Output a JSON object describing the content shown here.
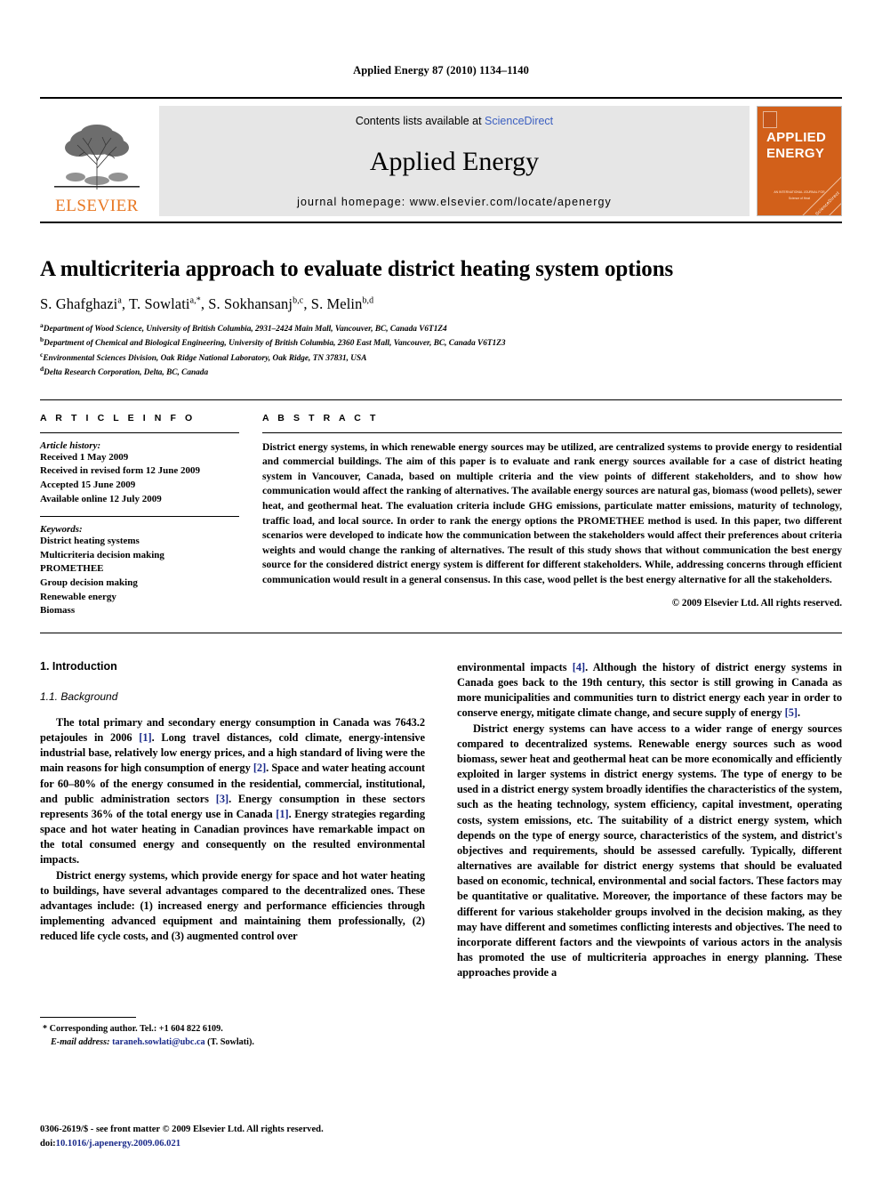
{
  "running_head": "Applied Energy 87 (2010) 1134–1140",
  "masthead": {
    "publisher_name": "ELSEVIER",
    "contents_prefix": "Contents lists available at ",
    "contents_link": "ScienceDirect",
    "journal_name": "Applied Energy",
    "homepage": "journal homepage: www.elsevier.com/locate/apenergy",
    "cover": {
      "line1": "APPLIED",
      "line2": "ENERGY",
      "foot1": "AN INTERNATIONAL JOURNAL FOR",
      "foot2": "Science of Heat",
      "ribbon": "ScienceDirect"
    },
    "accent_color": "#D2601A",
    "link_color": "#3b5fc0"
  },
  "article": {
    "title": "A multicriteria approach to evaluate district heating system options",
    "authors": [
      {
        "name": "S. Ghafghazi",
        "marks": "a"
      },
      {
        "name": "T. Sowlati",
        "marks": "a,*"
      },
      {
        "name": "S. Sokhansanj",
        "marks": "b,c"
      },
      {
        "name": "S. Melin",
        "marks": "b,d"
      }
    ],
    "affiliations": [
      {
        "mark": "a",
        "text": "Department of Wood Science, University of British Columbia, 2931–2424 Main Mall, Vancouver, BC, Canada V6T1Z4"
      },
      {
        "mark": "b",
        "text": "Department of Chemical and Biological Engineering, University of British Columbia, 2360 East Mall, Vancouver, BC, Canada V6T1Z3"
      },
      {
        "mark": "c",
        "text": "Environmental Sciences Division, Oak Ridge National Laboratory, Oak Ridge, TN 37831, USA"
      },
      {
        "mark": "d",
        "text": "Delta Research Corporation, Delta, BC, Canada"
      }
    ]
  },
  "article_info": {
    "heading": "A R T I C L E    I N F O",
    "history_label": "Article history:",
    "history": [
      "Received 1 May 2009",
      "Received in revised form 12 June 2009",
      "Accepted 15 June 2009",
      "Available online 12 July 2009"
    ],
    "keywords_label": "Keywords:",
    "keywords": [
      "District heating systems",
      "Multicriteria decision making",
      "PROMETHEE",
      "Group decision making",
      "Renewable energy",
      "Biomass"
    ]
  },
  "abstract": {
    "heading": "A B S T R A C T",
    "text": "District energy systems, in which renewable energy sources may be utilized, are centralized systems to provide energy to residential and commercial buildings. The aim of this paper is to evaluate and rank energy sources available for a case of district heating system in Vancouver, Canada, based on multiple criteria and the view points of different stakeholders, and to show how communication would affect the ranking of alternatives. The available energy sources are natural gas, biomass (wood pellets), sewer heat, and geothermal heat. The evaluation criteria include GHG emissions, particulate matter emissions, maturity of technology, traffic load, and local source. In order to rank the energy options the PROMETHEE method is used. In this paper, two different scenarios were developed to indicate how the communication between the stakeholders would affect their preferences about criteria weights and would change the ranking of alternatives. The result of this study shows that without communication the best energy source for the considered district energy system is different for different stakeholders. While, addressing concerns through efficient communication would result in a general consensus. In this case, wood pellet is the best energy alternative for all the stakeholders.",
    "copyright": "© 2009 Elsevier Ltd. All rights reserved."
  },
  "body": {
    "section_heading": "1. Introduction",
    "subsection_heading": "1.1. Background",
    "left_paragraphs": [
      "The total primary and secondary energy consumption in Canada was 7643.2 petajoules in 2006 [1]. Long travel distances, cold climate, energy-intensive industrial base, relatively low energy prices, and a high standard of living were the main reasons for high consumption of energy [2]. Space and water heating account for 60–80% of the energy consumed in the residential, commercial, institutional, and public administration sectors [3]. Energy consumption in these sectors represents 36% of the total energy use in Canada [1]. Energy strategies regarding space and hot water heating in Canadian provinces have remarkable impact on the total consumed energy and consequently on the resulted environmental impacts.",
      "District energy systems, which provide energy for space and hot water heating to buildings, have several advantages compared to the decentralized ones. These advantages include: (1) increased energy and performance efficiencies through implementing advanced equipment and maintaining them professionally, (2) reduced life cycle costs, and (3) augmented control over"
    ],
    "right_paragraphs": [
      "environmental impacts [4]. Although the history of district energy systems in Canada goes back to the 19th century, this sector is still growing in Canada as more municipalities and communities turn to district energy each year in order to conserve energy, mitigate climate change, and secure supply of energy [5].",
      "District energy systems can have access to a wider range of energy sources compared to decentralized systems. Renewable energy sources such as wood biomass, sewer heat and geothermal heat can be more economically and efficiently exploited in larger systems in district energy systems. The type of energy to be used in a district energy system broadly identifies the characteristics of the system, such as the heating technology, system efficiency, capital investment, operating costs, system emissions, etc. The suitability of a district energy system, which depends on the type of energy source, characteristics of the system, and district's objectives and requirements, should be assessed carefully. Typically, different alternatives are available for district energy systems that should be evaluated based on economic, technical, environmental and social factors. These factors may be quantitative or qualitative. Moreover, the importance of these factors may be different for various stakeholder groups involved in the decision making, as they may have different and sometimes conflicting interests and objectives. The need to incorporate different factors and the viewpoints of various actors in the analysis has promoted the use of multicriteria approaches in energy planning. These approaches provide a"
    ]
  },
  "footnote": {
    "corresponding": "* Corresponding author. Tel.: +1 604 822 6109.",
    "email_label": "E-mail address:",
    "email": "taraneh.sowlati@ubc.ca",
    "email_suffix": "(T. Sowlati)."
  },
  "page_footer": {
    "issn_line": "0306-2619/$ - see front matter © 2009 Elsevier Ltd. All rights reserved.",
    "doi_label": "doi:",
    "doi": "10.1016/j.apenergy.2009.06.021"
  }
}
